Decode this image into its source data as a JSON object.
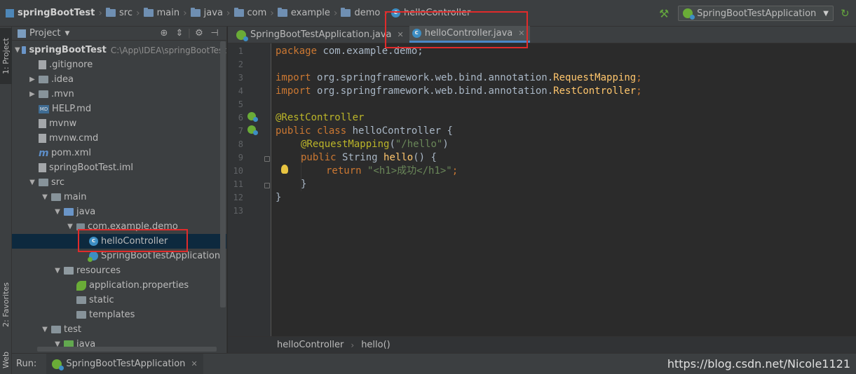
{
  "breadcrumb": [
    "springBootTest",
    "src",
    "main",
    "java",
    "com",
    "example",
    "demo",
    "helloController"
  ],
  "toolbar": {
    "run_config": "SpringBootTestApplication"
  },
  "sidebar_tabs": {
    "project": "1: Project",
    "favorites": "2: Favorites",
    "web": "Web"
  },
  "project_panel": {
    "title": "Project",
    "root_name": "springBootTest",
    "root_path": "C:\\App\\IDEA\\springBootTest",
    "items": [
      ".gitignore",
      ".idea",
      ".mvn",
      "HELP.md",
      "mvnw",
      "mvnw.cmd",
      "pom.xml",
      "springBootTest.iml",
      "src",
      "main",
      "java",
      "com.example.demo",
      "helloController",
      "SpringBootTestApplication",
      "resources",
      "application.properties",
      "static",
      "templates",
      "test",
      "java"
    ]
  },
  "editor": {
    "tabs": [
      "SpringBootTestApplication.java",
      "helloController.java"
    ],
    "line_numbers": [
      "1",
      "2",
      "3",
      "4",
      "5",
      "6",
      "7",
      "8",
      "9",
      "10",
      "11",
      "12",
      "13"
    ],
    "code": {
      "l1_kw": "package ",
      "l1_rest": "com.example.demo;",
      "l3_kw": "import ",
      "l3_pkg": "org.springframework.web.bind.annotation.",
      "l3_cls": "RequestMapping",
      "l3_end": ";",
      "l4_kw": "import ",
      "l4_pkg": "org.springframework.web.bind.annotation.",
      "l4_cls": "RestController",
      "l4_end": ";",
      "l6_ann": "@RestController",
      "l7_kw1": "public ",
      "l7_kw2": "class ",
      "l7_rest": "helloController {",
      "l8_ann": "@RequestMapping",
      "l8_open": "(",
      "l8_str": "\"/hello\"",
      "l8_close": ")",
      "l9_kw": "public ",
      "l9_type": "String ",
      "l9_fn": "hello",
      "l9_rest": "() {",
      "l10_kw": "return ",
      "l10_str": "\"<h1>成功</h1>\"",
      "l10_end": ";",
      "l11": "}",
      "l12": "}"
    },
    "footer": [
      "helloController",
      "hello()"
    ]
  },
  "run_bar": {
    "label": "Run:",
    "tab": "SpringBootTestApplication"
  },
  "watermark": "https://blog.csdn.net/Nicole1121",
  "colors": {
    "background": "#2b2b2b",
    "panel": "#3c3f41",
    "keyword": "#cc7832",
    "annotation": "#bbb529",
    "string": "#6a8759",
    "function": "#ffc66d",
    "selection": "#0d293e",
    "highlight_box": "#e02b2b"
  }
}
